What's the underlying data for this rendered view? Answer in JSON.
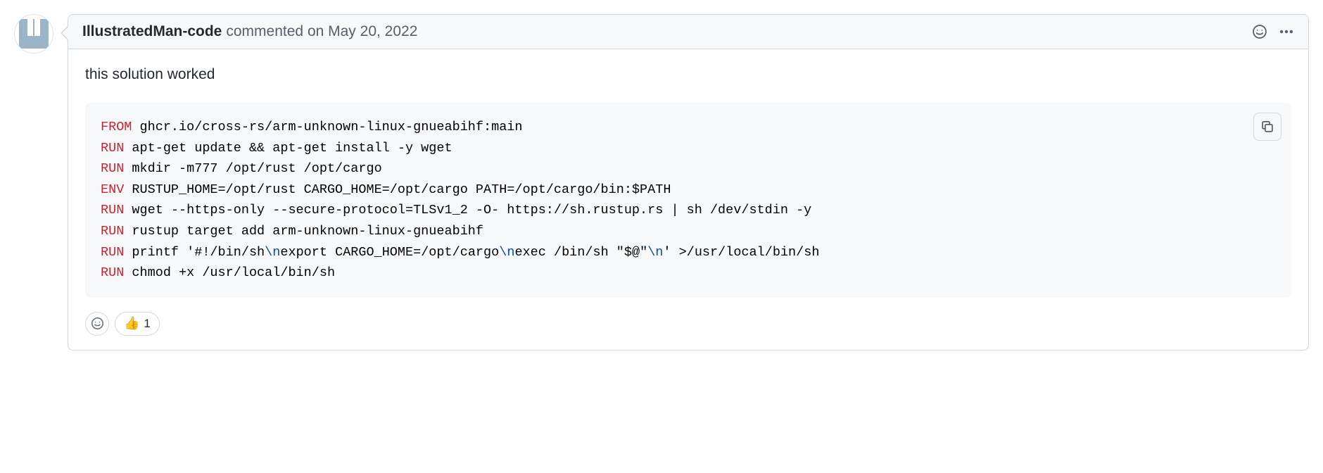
{
  "comment": {
    "author": "IllustratedMan-code",
    "action_prefix": "commented ",
    "timestamp": "on May 20, 2022",
    "body_text": "this solution worked",
    "code": {
      "lines": [
        {
          "kw": "FROM",
          "rest": " ghcr.io/cross-rs/arm-unknown-linux-gnueabihf:main"
        },
        {
          "kw": "RUN",
          "rest": " apt-get update && apt-get install -y wget"
        },
        {
          "kw": "RUN",
          "rest": " mkdir -m777 /opt/rust /opt/cargo"
        },
        {
          "kw": "ENV",
          "rest": " RUSTUP_HOME=/opt/rust CARGO_HOME=/opt/cargo PATH=/opt/cargo/bin:$PATH"
        },
        {
          "kw": "RUN",
          "rest": " wget --https-only --secure-protocol=TLSv1_2 -O- https://sh.rustup.rs | sh /dev/stdin -y"
        },
        {
          "kw": "RUN",
          "rest": " rustup target add arm-unknown-linux-gnueabihf"
        },
        {
          "kw": "RUN",
          "parts": [
            {
              "t": "plain",
              "v": " printf '#!/bin/sh"
            },
            {
              "t": "esc",
              "v": "\\n"
            },
            {
              "t": "plain",
              "v": "export CARGO_HOME=/opt/cargo"
            },
            {
              "t": "esc",
              "v": "\\n"
            },
            {
              "t": "plain",
              "v": "exec /bin/sh \"$@\""
            },
            {
              "t": "esc",
              "v": "\\n"
            },
            {
              "t": "plain",
              "v": "' >/usr/local/bin/sh"
            }
          ]
        },
        {
          "kw": "RUN",
          "rest": " chmod +x /usr/local/bin/sh"
        }
      ]
    },
    "reactions": [
      {
        "emoji": "👍",
        "count": "1"
      }
    ]
  },
  "icons": {
    "smiley": "smiley-icon",
    "kebab": "kebab-icon",
    "copy": "copy-icon"
  }
}
